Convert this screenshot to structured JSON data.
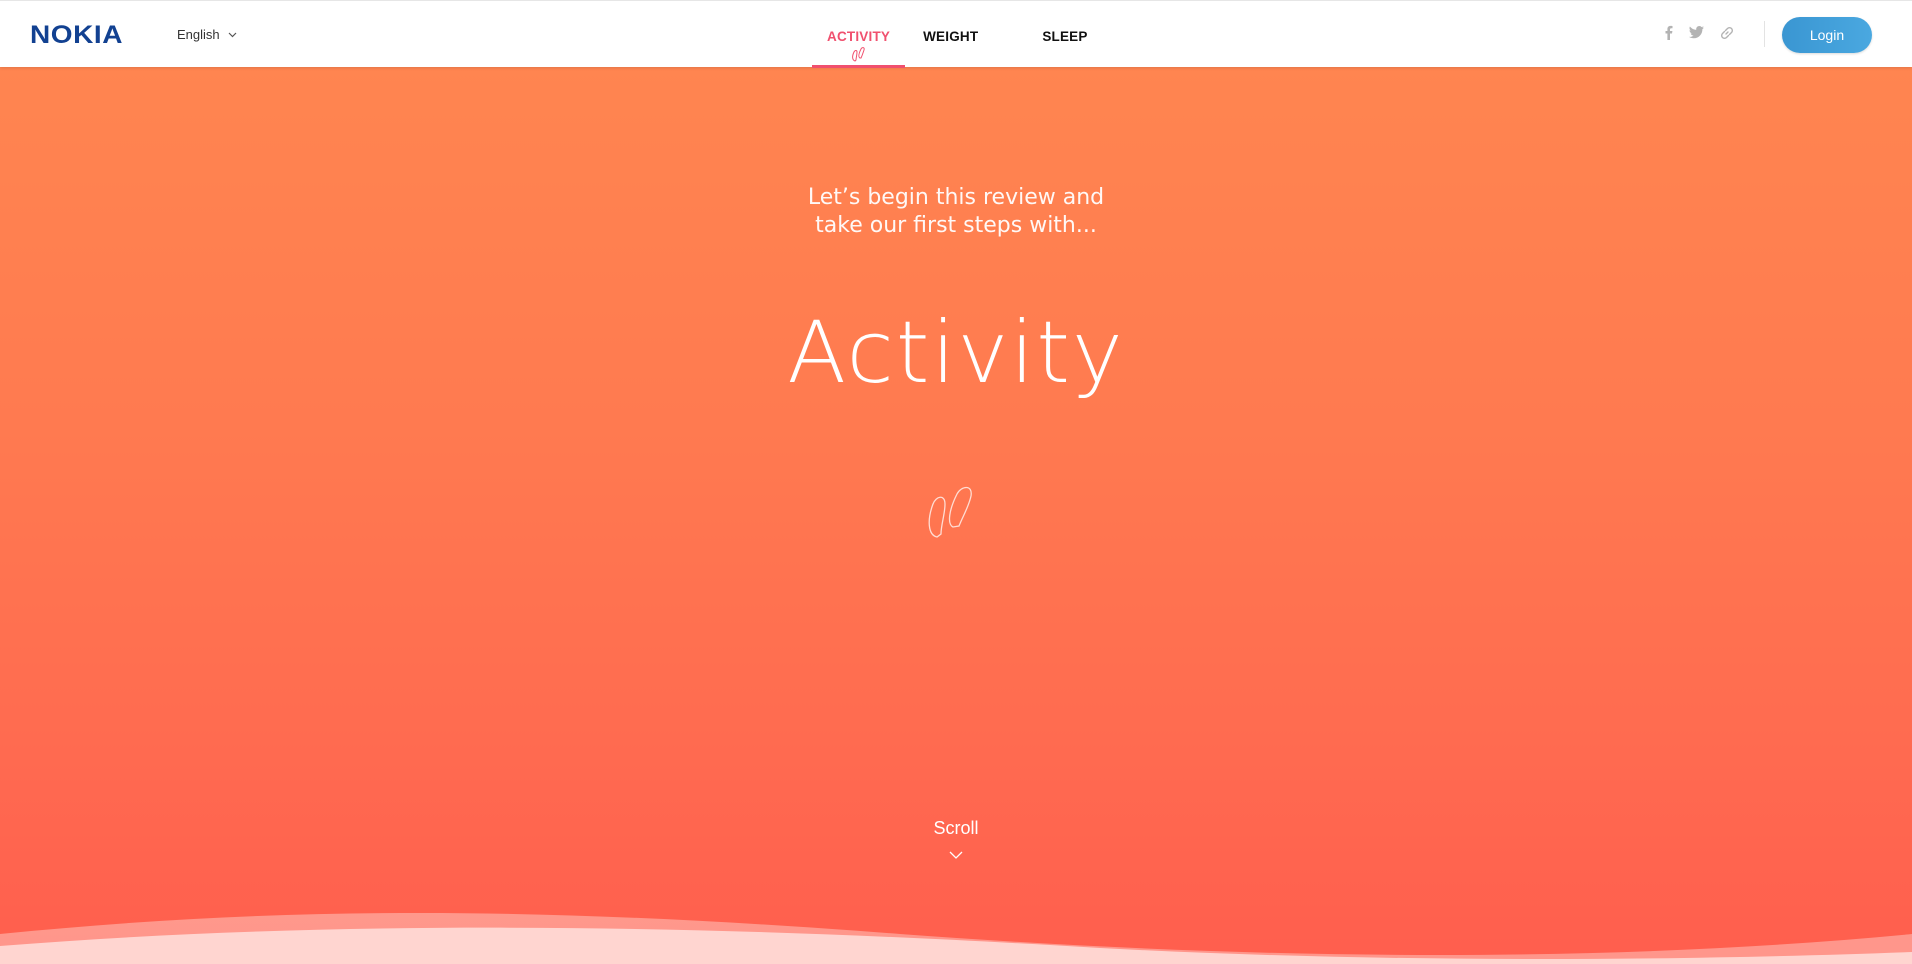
{
  "header": {
    "logo_text": "NOKIA",
    "language": "English",
    "nav": [
      {
        "label": "ACTIVITY",
        "active": true
      },
      {
        "label": "WEIGHT",
        "active": false
      },
      {
        "label": "SLEEP",
        "active": false
      }
    ],
    "social_icons": [
      "facebook-icon",
      "twitter-icon",
      "link-icon"
    ],
    "login_label": "Login"
  },
  "hero": {
    "intro_line1": "Let’s begin this review and",
    "intro_line2": "take our first steps with...",
    "title": "Activity",
    "scroll_label": "Scroll"
  },
  "colors": {
    "brand": "#124191",
    "accent": "#f0506e",
    "login": "#3a96d2",
    "hero_top": "#ff8550",
    "hero_bottom": "#ff5e4e"
  }
}
